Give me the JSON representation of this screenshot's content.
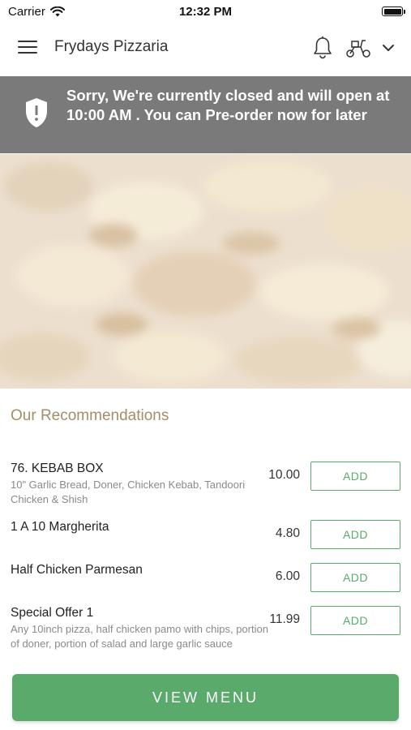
{
  "status_bar": {
    "carrier": "Carrier",
    "time": "12:32 PM"
  },
  "header": {
    "title": "Frydays Pizzaria"
  },
  "banner": {
    "message": "Sorry, We're currently closed and will open at 10:00 AM . You can Pre-order now for later"
  },
  "recommendations": {
    "title": "Our Recommendations",
    "items": [
      {
        "name": "76. KEBAB BOX",
        "description": "10\" Garlic Bread, Doner, Chicken Kebab, Tandoori Chicken & Shish",
        "price": "10.00",
        "add_label": "ADD"
      },
      {
        "name": "1 A 10 Margherita",
        "description": "",
        "price": "4.80",
        "add_label": "ADD"
      },
      {
        "name": "Half Chicken Parmesan",
        "description": "",
        "price": "6.00",
        "add_label": "ADD"
      },
      {
        "name": "Special Offer 1",
        "description": "Any 10inch pizza, half chicken pamo with chips, portion of doner, portion of salad and large garlic sauce",
        "price": "11.99",
        "add_label": "ADD"
      }
    ]
  },
  "footer": {
    "view_menu_label": "VIEW MENU"
  },
  "colors": {
    "accent_green": "#5aaa6c",
    "banner_gray": "#7a7a7a",
    "section_title": "#a38e69"
  },
  "icons": [
    "menu-icon",
    "bell-icon",
    "scooter-icon",
    "chevron-down-icon",
    "shield-alert-icon",
    "wifi-icon",
    "battery-icon"
  ]
}
